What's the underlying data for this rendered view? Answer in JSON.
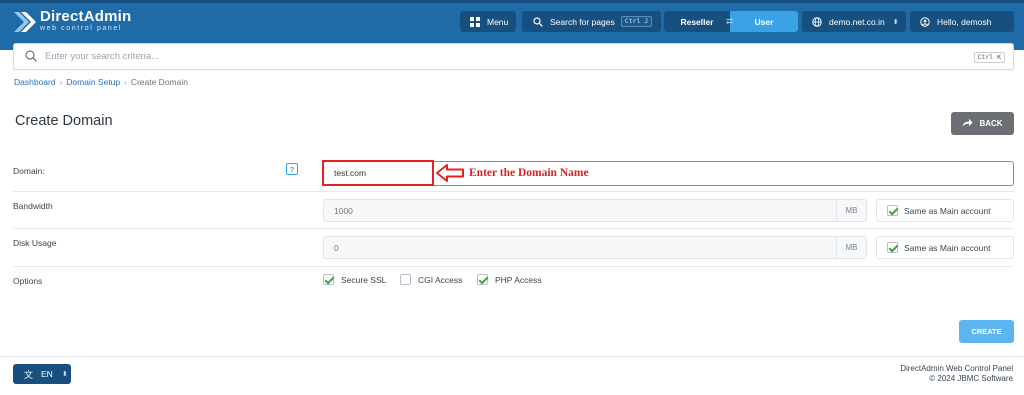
{
  "topbar": {
    "brand_title": "DirectAdmin",
    "brand_subtitle": "web control panel",
    "menu_label": "Menu",
    "search_pages_label": "Search for pages",
    "search_pages_shortcut": "Ctrl J",
    "reseller_label": "Reseller",
    "user_label": "User",
    "domain_selector": "demo.net.co.in",
    "user_greeting": "Hello, demosh"
  },
  "search": {
    "placeholder": "Enter your search criteria...",
    "shortcut": "Ctrl K"
  },
  "breadcrumb": [
    "Dashboard",
    "Domain Setup",
    "Create Domain"
  ],
  "page": {
    "title": "Create Domain",
    "back_label": "BACK"
  },
  "form": {
    "domain": {
      "label": "Domain:",
      "help": "?",
      "value": "test.com"
    },
    "bandwidth": {
      "label": "Bandwidth",
      "placeholder": "1000",
      "unit": "MB",
      "same_label": "Same as Main account",
      "same_checked": true
    },
    "disk_usage": {
      "label": "Disk Usage",
      "placeholder": "0",
      "unit": "MB",
      "same_label": "Same as Main account",
      "same_checked": true
    },
    "options": {
      "label": "Options",
      "items": [
        {
          "label": "Secure SSL",
          "checked": true
        },
        {
          "label": "CGI Access",
          "checked": false
        },
        {
          "label": "PHP Access",
          "checked": true
        }
      ]
    },
    "create_label": "CREATE"
  },
  "annotation": {
    "text": "Enter the Domain Name",
    "color": "#d8232a"
  },
  "footer": {
    "lang_label": "EN",
    "line1": "DirectAdmin Web Control Panel",
    "line2": "© 2024 JBMC Software"
  },
  "colors": {
    "topbar": "#1e6ba8",
    "accent": "#3aa3e6",
    "dark_button": "#174f7f",
    "back_button": "#6c7075",
    "create_button": "#5ab5f0"
  }
}
